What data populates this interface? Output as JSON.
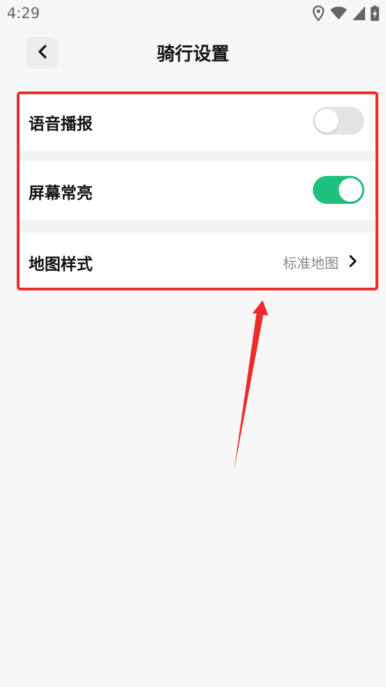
{
  "status_bar": {
    "time": "4:29",
    "icons": [
      "location-icon",
      "wifi-icon",
      "signal-icon",
      "battery-charging-icon"
    ]
  },
  "header": {
    "title": "骑行设置",
    "back_icon": "chevron-left-icon"
  },
  "settings": {
    "voice": {
      "label": "语音播报",
      "enabled": false
    },
    "screen": {
      "label": "屏幕常亮",
      "enabled": true
    },
    "map": {
      "label": "地图样式",
      "value": "标准地图",
      "icon": "chevron-right-icon"
    }
  },
  "colors": {
    "background": "#f7f7f7",
    "toggle_on": "#1ec07d",
    "toggle_off": "#e3e3e3",
    "annotation": "#ee2b2b"
  }
}
